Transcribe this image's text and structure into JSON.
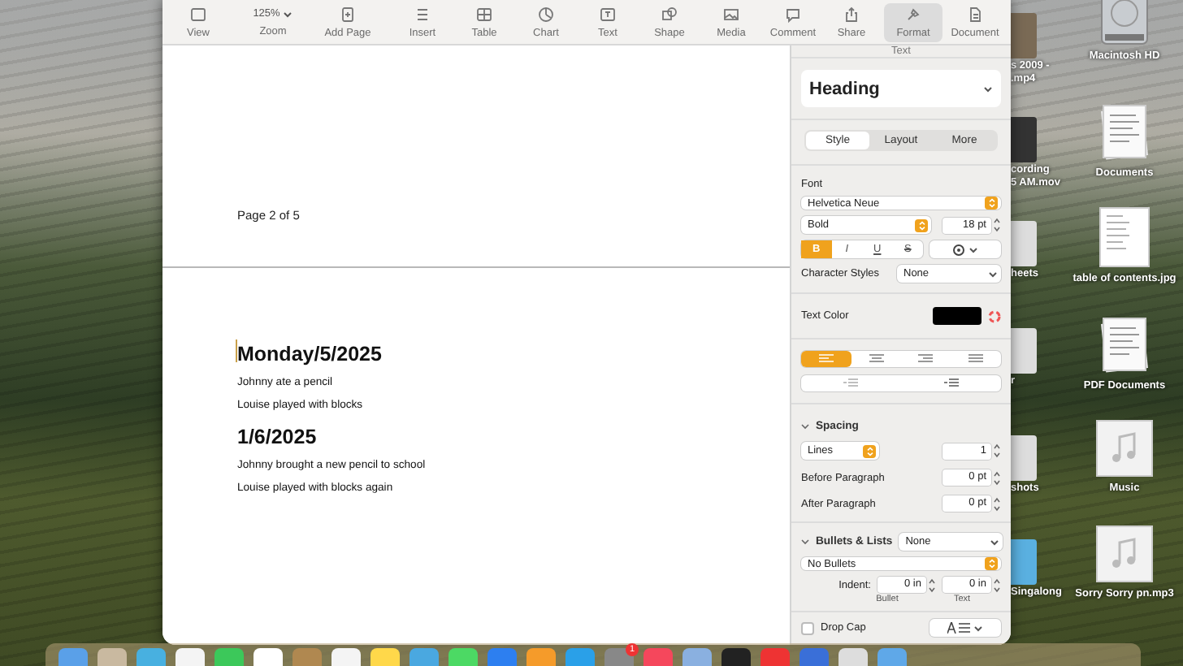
{
  "toolbar": {
    "left": [
      {
        "label": "View",
        "kind": "view"
      },
      {
        "label": "Zoom",
        "kind": "zoom",
        "value": "125%"
      },
      {
        "label": "Add Page",
        "kind": "add-page"
      }
    ],
    "center": [
      {
        "label": "Insert",
        "kind": "insert"
      },
      {
        "label": "Table",
        "kind": "table"
      },
      {
        "label": "Chart",
        "kind": "chart"
      },
      {
        "label": "Text",
        "kind": "text"
      },
      {
        "label": "Shape",
        "kind": "shape"
      },
      {
        "label": "Media",
        "kind": "media"
      },
      {
        "label": "Comment",
        "kind": "comment"
      }
    ],
    "right": [
      {
        "label": "Share",
        "kind": "share",
        "selected": false
      },
      {
        "label": "Format",
        "kind": "format",
        "selected": true
      },
      {
        "label": "Document",
        "kind": "document",
        "selected": false
      }
    ]
  },
  "document": {
    "footer": "Page 2 of 5",
    "paragraphs": [
      {
        "kind": "heading",
        "text": "Monday/5/2025"
      },
      {
        "kind": "body",
        "text": "Johnny ate a pencil"
      },
      {
        "kind": "body",
        "text": "Louise played with blocks"
      },
      {
        "kind": "heading",
        "text": "1/6/2025"
      },
      {
        "kind": "body",
        "text": "Johnny brought a new pencil to school"
      },
      {
        "kind": "body",
        "text": "Louise played with blocks again"
      }
    ]
  },
  "inspector": {
    "title": "Text",
    "paragraph_style": "Heading",
    "tabs": [
      {
        "label": "Style",
        "selected": true
      },
      {
        "label": "Layout",
        "selected": false
      },
      {
        "label": "More",
        "selected": false
      }
    ],
    "font": {
      "label": "Font",
      "family": "Helvetica Neue",
      "typeface": "Bold",
      "size": "18 pt",
      "styles": [
        {
          "label": "B",
          "selected": true
        },
        {
          "label": "I",
          "selected": false
        },
        {
          "label": "U",
          "selected": false
        },
        {
          "label": "S",
          "selected": false
        }
      ]
    },
    "character_styles": {
      "label": "Character Styles",
      "value": "None"
    },
    "text_color": {
      "label": "Text Color",
      "color": "#000000"
    },
    "alignment": [
      {
        "kind": "left",
        "selected": true
      },
      {
        "kind": "center",
        "selected": false
      },
      {
        "kind": "right",
        "selected": false
      },
      {
        "kind": "justify",
        "selected": false
      }
    ],
    "spacing": {
      "label": "Spacing",
      "expanded": true,
      "mode": "Lines",
      "value": "1",
      "before_label": "Before Paragraph",
      "before": "0 pt",
      "after_label": "After Paragraph",
      "after": "0 pt"
    },
    "bullets": {
      "label": "Bullets & Lists",
      "expanded": true,
      "value": "None",
      "style": "No Bullets",
      "indent_label": "Indent:",
      "bullet_indent": "0 in",
      "text_indent": "0 in",
      "bullet_caption": "Bullet",
      "text_caption": "Text"
    },
    "drop_cap": {
      "label": "Drop Cap",
      "checked": false
    }
  },
  "desktop_icons": [
    {
      "label": "Macintosh HD",
      "kind": "drive"
    },
    {
      "label": "Documents",
      "kind": "stack"
    },
    {
      "label": "table of contents.jpg",
      "kind": "page"
    },
    {
      "label": "PDF Documents",
      "kind": "stack"
    },
    {
      "label": "Music",
      "kind": "music"
    },
    {
      "label": "Sorry Sorry pn.mp3",
      "kind": "music"
    }
  ],
  "partial_icons": [
    {
      "lines": [
        "s 2009 -",
        ".mp4"
      ]
    },
    {
      "lines": [
        "cording",
        "5 AM.mov"
      ]
    },
    {
      "lines": [
        "heets"
      ]
    },
    {
      "lines": [
        "r"
      ]
    },
    {
      "lines": [
        "shots"
      ]
    },
    {
      "lines": [
        "Singalong"
      ]
    }
  ],
  "dock": {
    "badge": "1"
  }
}
